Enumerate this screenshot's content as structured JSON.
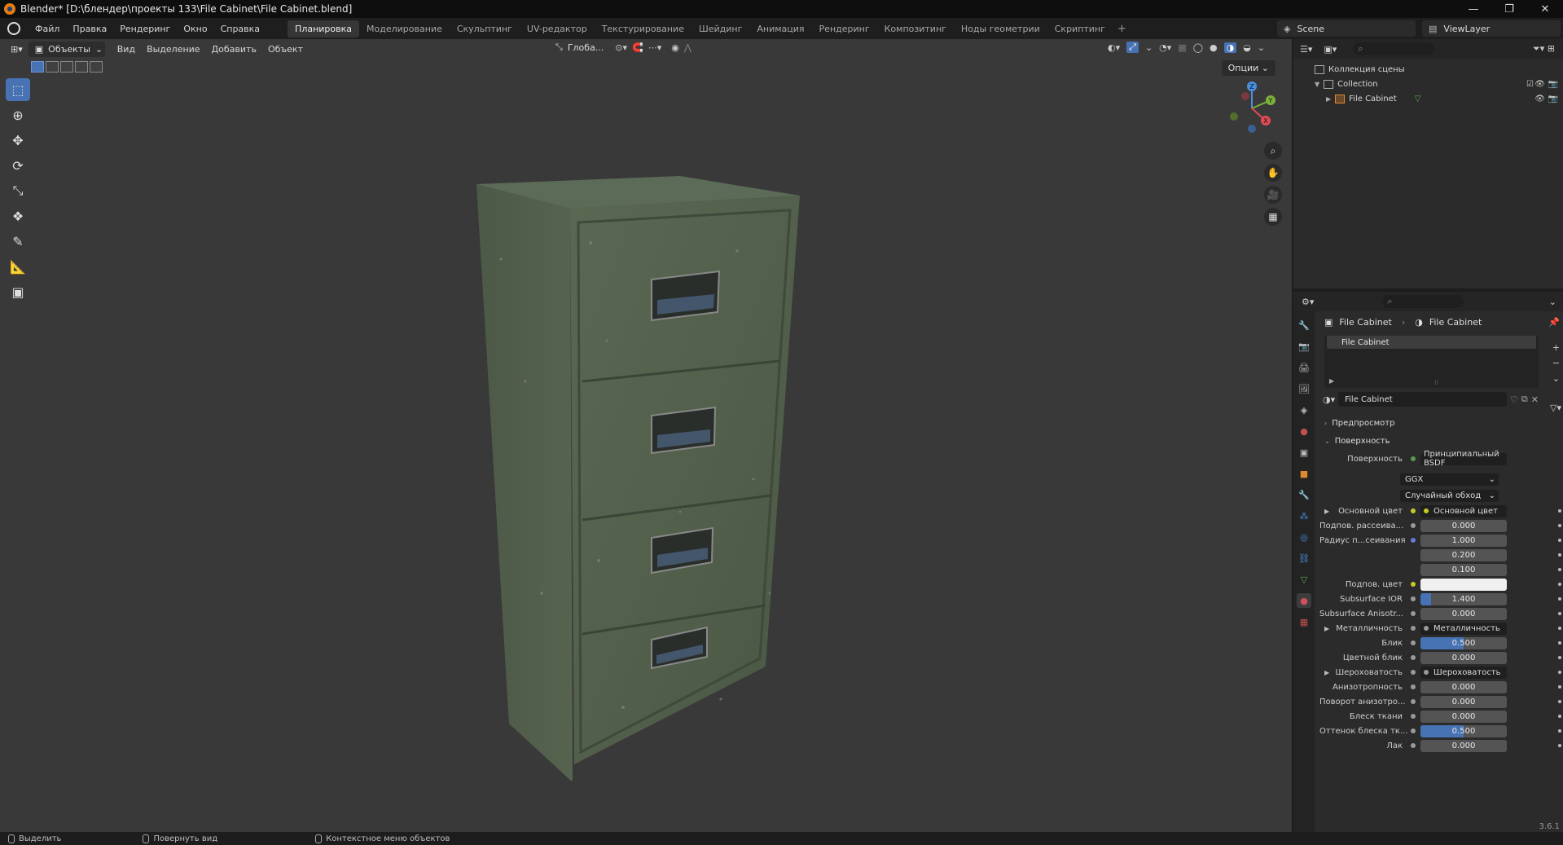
{
  "window": {
    "title": "Blender* [D:\\блендер\\проекты 133\\File Cabinet\\File Cabinet.blend]",
    "minimize": "—",
    "maximize": "❐",
    "close": "✕"
  },
  "menu": {
    "items": [
      "Файл",
      "Правка",
      "Рендеринг",
      "Окно",
      "Справка"
    ],
    "workspaces": [
      "Планировка",
      "Моделирование",
      "Скульптинг",
      "UV-редактор",
      "Текстурирование",
      "Шейдинг",
      "Анимация",
      "Рендеринг",
      "Композитинг",
      "Ноды геометрии",
      "Скриптинг"
    ],
    "active_workspace": 0,
    "add": "+",
    "scene": "Scene",
    "view_layer": "ViewLayer"
  },
  "viewport": {
    "mode": "Объекты",
    "menus": [
      "Вид",
      "Выделение",
      "Добавить",
      "Объект"
    ],
    "orientation": "Глоба...",
    "options": "Опции",
    "gizmo": {
      "x": "X",
      "y": "Y",
      "z": "Z"
    }
  },
  "outliner": {
    "scene_collection": "Коллекция сцены",
    "collection": "Collection",
    "object": "File Cabinet"
  },
  "properties": {
    "breadcrumb_object": "File Cabinet",
    "breadcrumb_material": "File Cabinet",
    "slot": "File Cabinet",
    "material_name": "File Cabinet",
    "preview": "Предпросмотр",
    "surface_panel": "Поверхность",
    "surface_label": "Поверхность",
    "surface_value": "Принципиальный BSDF",
    "distribution": "GGX",
    "subsurface_method": "Случайный обход",
    "rows": [
      {
        "label": "Основной цвет",
        "type": "link",
        "value": "Основной цвет",
        "dot": "y",
        "expand": true
      },
      {
        "label": "Подпов. рассеива...",
        "type": "num",
        "value": "0.000",
        "dot": "gr",
        "fill": 0
      },
      {
        "label": "Радиус п...сеивания",
        "type": "num",
        "value": "1.000",
        "dot": "b",
        "fill": 0
      },
      {
        "label": "",
        "type": "num",
        "value": "0.200",
        "dot": "",
        "fill": 0
      },
      {
        "label": "",
        "type": "num",
        "value": "0.100",
        "dot": "",
        "fill": 0
      },
      {
        "label": "Подпов. цвет",
        "type": "color",
        "value": "",
        "dot": "y",
        "fill": 0
      },
      {
        "label": "Subsurface IOR",
        "type": "num",
        "value": "1.400",
        "dot": "gr",
        "fill": 0.12
      },
      {
        "label": "Subsurface Anisotr...",
        "type": "num",
        "value": "0.000",
        "dot": "gr",
        "fill": 0
      },
      {
        "label": "Металличность",
        "type": "link",
        "value": "Металличность",
        "dot": "gr",
        "expand": true
      },
      {
        "label": "Блик",
        "type": "num",
        "value": "0.500",
        "dot": "gr",
        "fill": 0.5
      },
      {
        "label": "Цветной блик",
        "type": "num",
        "value": "0.000",
        "dot": "gr",
        "fill": 0
      },
      {
        "label": "Шероховатость",
        "type": "link",
        "value": "Шероховатость",
        "dot": "gr",
        "expand": true
      },
      {
        "label": "Анизотропность",
        "type": "num",
        "value": "0.000",
        "dot": "gr",
        "fill": 0
      },
      {
        "label": "Поворот анизотро...",
        "type": "num",
        "value": "0.000",
        "dot": "gr",
        "fill": 0
      },
      {
        "label": "Блеск ткани",
        "type": "num",
        "value": "0.000",
        "dot": "gr",
        "fill": 0
      },
      {
        "label": "Оттенок блеска тк...",
        "type": "num",
        "value": "0.500",
        "dot": "gr",
        "fill": 0.5
      },
      {
        "label": "Лак",
        "type": "num",
        "value": "0.000",
        "dot": "gr",
        "fill": 0
      }
    ]
  },
  "status": {
    "select": "Выделить",
    "rotate": "Повернуть вид",
    "context": "Контекстное меню объектов",
    "version": "3.6.1"
  },
  "colors": {
    "accent": "#4772b3",
    "viewport_bg": "#393939",
    "cabinet": "#5d6b55"
  }
}
